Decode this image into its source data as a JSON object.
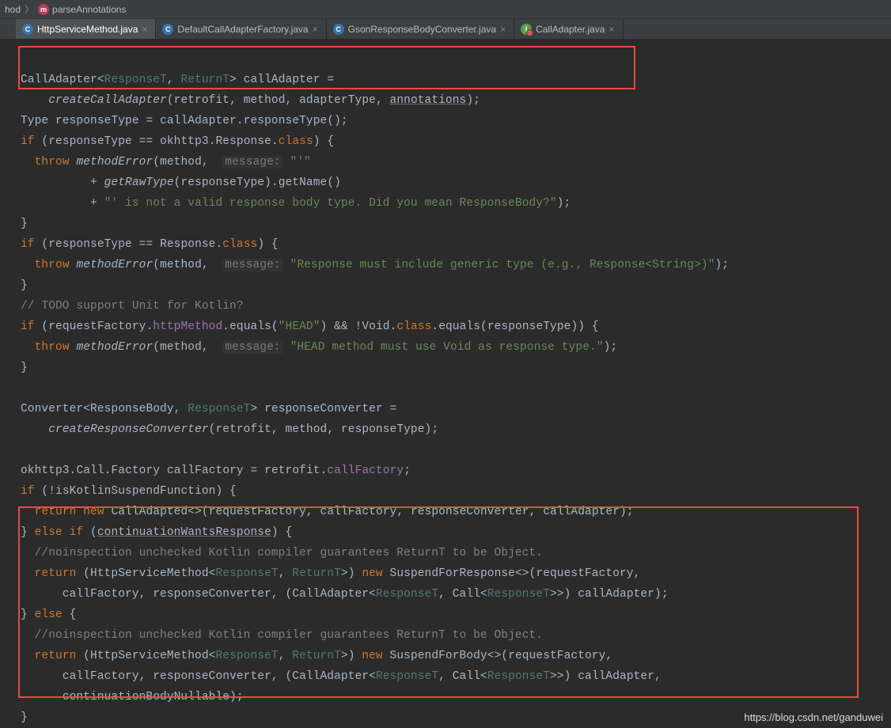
{
  "breadcrumb": {
    "item1": "hod",
    "item2": "parseAnnotations"
  },
  "tabs": [
    {
      "label": "HttpServiceMethod.java",
      "active": true,
      "iconClass": "fi-blue",
      "iconLetter": "C"
    },
    {
      "label": "DefaultCallAdapterFactory.java",
      "active": false,
      "iconClass": "fi-blue",
      "iconLetter": "C"
    },
    {
      "label": "GsonResponseBodyConverter.java",
      "active": false,
      "iconClass": "fi-blue",
      "iconLetter": "C"
    },
    {
      "label": "CallAdapter.java",
      "active": false,
      "iconClass": "fi-green",
      "iconLetter": "I"
    }
  ],
  "code": {
    "identifiers": {
      "CallAdapter": "CallAdapter",
      "ResponseT": "ResponseT",
      "ReturnT": "ReturnT",
      "callAdapter": "callAdapter",
      "createCallAdapter": "createCallAdapter",
      "retrofit": "retrofit",
      "methodVar": "method",
      "adapterType": "adapterType",
      "annotations": "annotations",
      "Type": "Type",
      "responseType": "responseType",
      "okhttp3": "okhttp3",
      "Response": "Response",
      "classKw": "class",
      "if": "if",
      "else": "else",
      "throw": "throw",
      "return": "return",
      "new": "new",
      "methodError": "methodError",
      "messageHint": "message:",
      "getRawType": "getRawType",
      "getName": "getName",
      "todo": "// TODO support Unit for Kotlin?",
      "requestFactory": "requestFactory",
      "httpMethod": "httpMethod",
      "equals": "equals",
      "Void": "Void",
      "Converter": "Converter",
      "ResponseBody": "ResponseBody",
      "responseConverter": "responseConverter",
      "createResponseConverter": "createResponseConverter",
      "Call": "Call",
      "Factory": "Factory",
      "callFactory": "callFactory",
      "isKotlinSuspendFunction": "isKotlinSuspendFunction",
      "CallAdapted": "CallAdapted",
      "continuationWantsResponse": "continuationWantsResponse",
      "noinspection": "//noinspection unchecked Kotlin compiler guarantees ReturnT to be Object.",
      "HttpServiceMethod": "HttpServiceMethod",
      "SuspendForResponse": "SuspendForResponse",
      "SuspendForBody": "SuspendForBody",
      "continuationBodyNullable": "continuationBodyNullable"
    },
    "strings": {
      "quote1open": "\"'\"",
      "quote1mid": "\"' is not a valid response body type. Did you mean ResponseBody?\"",
      "responseGeneric": "\"Response must include generic type (e.g., Response<String>)\"",
      "head": "\"HEAD\"",
      "headMsg": "\"HEAD method must use Void as response type.\""
    }
  },
  "watermark": "https://blog.csdn.net/ganduwei"
}
